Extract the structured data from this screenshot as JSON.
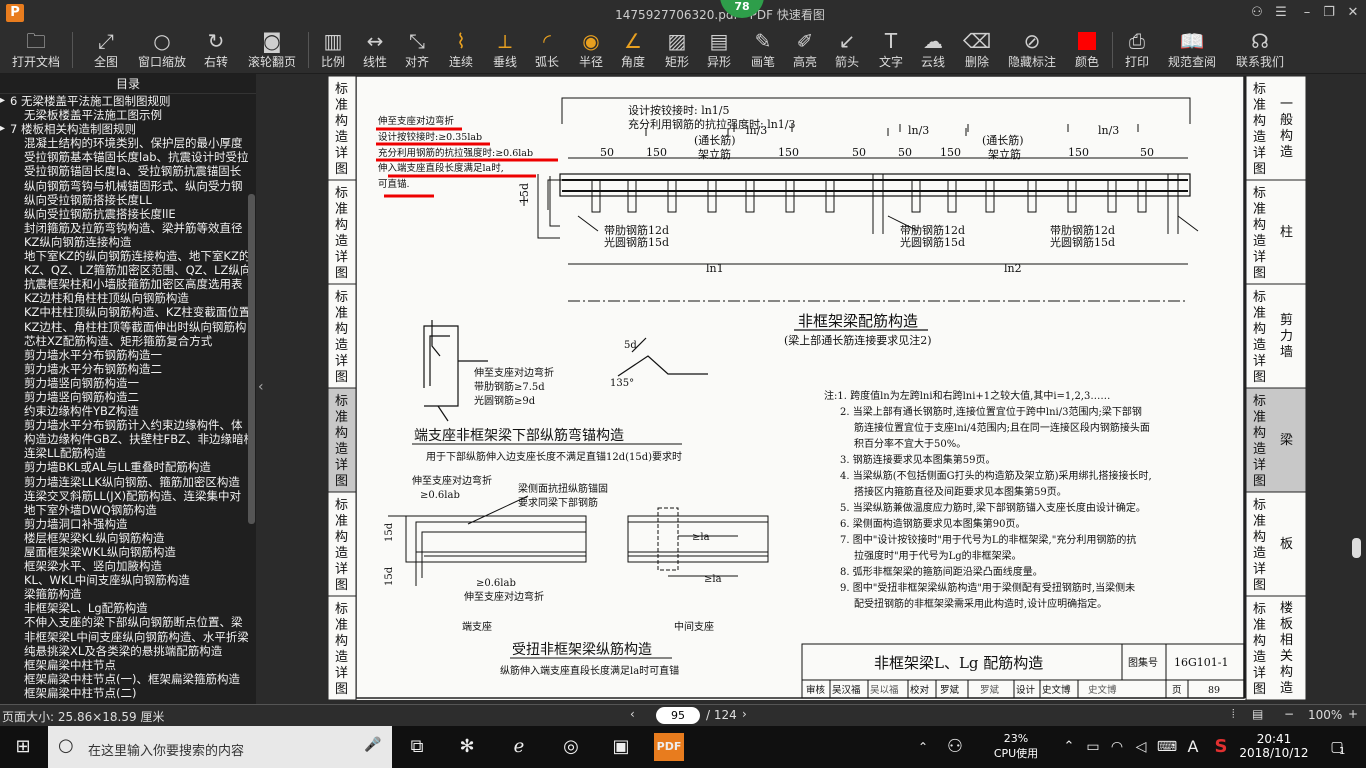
{
  "window": {
    "title": "1475927706320.pdf - PDF 快速看图",
    "badge": "78",
    "logo": "P"
  },
  "toolbar": [
    {
      "label": "打开文档",
      "icon": "folder-icon"
    },
    {
      "label": "全图",
      "icon": "fullscreen-icon"
    },
    {
      "label": "窗口缩放",
      "icon": "zoom-window-icon"
    },
    {
      "label": "右转",
      "icon": "rotate-right-icon"
    },
    {
      "label": "滚轮翻页",
      "icon": "mouse-wheel-icon"
    },
    {
      "label": "比例",
      "icon": "scale-icon"
    },
    {
      "label": "线性",
      "icon": "linear-dim-icon"
    },
    {
      "label": "对齐",
      "icon": "aligned-dim-icon"
    },
    {
      "label": "连续",
      "icon": "continuous-dim-icon"
    },
    {
      "label": "垂线",
      "icon": "perpendicular-icon"
    },
    {
      "label": "弧长",
      "icon": "arc-length-icon"
    },
    {
      "label": "半径",
      "icon": "radius-icon"
    },
    {
      "label": "角度",
      "icon": "angle-icon"
    },
    {
      "label": "矩形",
      "icon": "rectangle-area-icon"
    },
    {
      "label": "异形",
      "icon": "polygon-area-icon"
    },
    {
      "label": "画笔",
      "icon": "pen-icon"
    },
    {
      "label": "高亮",
      "icon": "highlighter-icon"
    },
    {
      "label": "箭头",
      "icon": "arrow-icon"
    },
    {
      "label": "文字",
      "icon": "text-icon"
    },
    {
      "label": "云线",
      "icon": "cloud-icon"
    },
    {
      "label": "删除",
      "icon": "eraser-icon"
    },
    {
      "label": "隐藏标注",
      "icon": "hide-eye-icon"
    },
    {
      "label": "颜色",
      "icon": "color-swatch-icon",
      "color": "#ff0000"
    },
    {
      "label": "打印",
      "icon": "printer-icon"
    },
    {
      "label": "规范查阅",
      "icon": "book-icon"
    },
    {
      "label": "联系我们",
      "icon": "support-icon"
    }
  ],
  "sidebar": {
    "header": "目录",
    "items": [
      {
        "text": "6 无梁楼盖平法施工图制图规则",
        "collapsed": true
      },
      {
        "text": "无梁板楼盖平法施工图示例",
        "collapsed": false
      },
      {
        "text": "7 楼板相关构造制图规则",
        "collapsed": true
      },
      {
        "text": "混凝土结构的环境类别、保护层的最小厚度",
        "collapsed": false
      },
      {
        "text": "受拉钢筋基本锚固长度lab、抗震设计时受拉",
        "collapsed": false
      },
      {
        "text": "受拉钢筋锚固长度la、受拉钢筋抗震锚固长",
        "collapsed": false
      },
      {
        "text": "纵向钢筋弯钩与机械锚固形式、纵向受力钢",
        "collapsed": false
      },
      {
        "text": "纵向受拉钢筋搭接长度LL",
        "collapsed": false
      },
      {
        "text": "纵向受拉钢筋抗震搭接长度llE",
        "collapsed": false
      },
      {
        "text": "封闭箍筋及拉筋弯钩构造、梁并筋等效直径",
        "collapsed": false
      },
      {
        "text": "KZ纵向钢筋连接构造",
        "collapsed": false
      },
      {
        "text": "地下室KZ的纵向钢筋连接构造、地下室KZ的",
        "collapsed": false
      },
      {
        "text": "KZ、QZ、LZ箍筋加密区范围、QZ、LZ纵向钢",
        "collapsed": false
      },
      {
        "text": "抗震框架柱和小墙肢箍筋加密区高度选用表",
        "collapsed": false
      },
      {
        "text": "KZ边柱和角柱柱顶纵向钢筋构造",
        "collapsed": false
      },
      {
        "text": "KZ中柱柱顶纵向钢筋构造、KZ柱变截面位置",
        "collapsed": false
      },
      {
        "text": "KZ边柱、角柱柱顶等截面伸出时纵向钢筋构",
        "collapsed": false
      },
      {
        "text": "芯柱XZ配筋构造、矩形箍筋复合方式",
        "collapsed": false
      },
      {
        "text": "剪力墙水平分布钢筋构造一",
        "collapsed": false
      },
      {
        "text": "剪力墙水平分布钢筋构造二",
        "collapsed": false
      },
      {
        "text": "剪力墙竖向钢筋构造一",
        "collapsed": false
      },
      {
        "text": "剪力墙竖向钢筋构造二",
        "collapsed": false
      },
      {
        "text": "约束边缘构件YBZ构造",
        "collapsed": false
      },
      {
        "text": "剪力墙水平分布钢筋计入约束边缘构件、体",
        "collapsed": false
      },
      {
        "text": "构造边缘构件GBZ、扶壁柱FBZ、非边缘暗柱",
        "collapsed": false
      },
      {
        "text": "连梁LL配筋构造",
        "collapsed": false
      },
      {
        "text": "剪力墙BKL或AL与LL重叠时配筋构造",
        "collapsed": false
      },
      {
        "text": "剪力墙连梁LLK纵向钢筋、箍筋加密区构造",
        "collapsed": false
      },
      {
        "text": "连梁交叉斜筋LL(JX)配筋构造、连梁集中对",
        "collapsed": false
      },
      {
        "text": "地下室外墙DWQ钢筋构造",
        "collapsed": false
      },
      {
        "text": "剪力墙洞口补强构造",
        "collapsed": false
      },
      {
        "text": "楼层框架梁KL纵向钢筋构造",
        "collapsed": false
      },
      {
        "text": "屋面框架梁WKL纵向钢筋构造",
        "collapsed": false
      },
      {
        "text": "框架梁水平、竖向加腋构造",
        "collapsed": false
      },
      {
        "text": "KL、WKL中间支座纵向钢筋构造",
        "collapsed": false
      },
      {
        "text": "梁箍筋构造",
        "collapsed": false
      },
      {
        "text": "非框架梁L、Lg配筋构造",
        "collapsed": false
      },
      {
        "text": "不伸入支座的梁下部纵向钢筋断点位置、梁",
        "collapsed": false
      },
      {
        "text": "非框架梁L中间支座纵向钢筋构造、水平折梁",
        "collapsed": false
      },
      {
        "text": "纯悬挑梁XL及各类梁的悬挑端配筋构造",
        "collapsed": false
      },
      {
        "text": "框架扁梁中柱节点",
        "collapsed": false
      },
      {
        "text": "框架扁梁中柱节点(一)、框架扁梁箍筋构造",
        "collapsed": false
      },
      {
        "text": "框架扁梁中柱节点(二)",
        "collapsed": false
      }
    ]
  },
  "document": {
    "left_tabs": [
      "标准构造详图",
      "标准构造详图",
      "标准构造详图",
      "标准构造详图",
      "标准构造详图",
      "标准构造详图"
    ],
    "right_tabs": [
      {
        "label": "标准构造详图",
        "section": "一般构造",
        "active": false
      },
      {
        "label": "标准构造详图",
        "section": "柱",
        "active": false
      },
      {
        "label": "标准构造详图",
        "section": "剪力墙",
        "active": false
      },
      {
        "label": "标准构造详图",
        "section": "梁",
        "active": true
      },
      {
        "label": "标准构造详图",
        "section": "板",
        "active": false
      },
      {
        "label": "标准构造详图",
        "section": "楼板相关构造",
        "active": false
      }
    ],
    "top_note": [
      "伸至支座对边弯折",
      "设计按铰接时:≥0.35lab",
      "充分利用钢筋的抗拉强度时:≥0.6lab",
      "伸入端支座直段长度满足la时,",
      "可直锚."
    ],
    "dim_notes": [
      "设计按铰接时: ln1/5",
      "充分利用钢筋的抗拉强度时: ln1/3"
    ],
    "labels": {
      "tongchang1": "(通长筋)",
      "jialijin": "架立筋",
      "tongchang2": "(通长筋)",
      "jialijin2": "架立筋",
      "ln3": "ln/3",
      "d50": "50",
      "d150": "150",
      "dai12": "带肋钢筋12d",
      "guang15": "光圆钢筋15d",
      "ln1": "ln1",
      "ln2": "ln2",
      "d15": "15d"
    },
    "main_title": "非框架梁配筋构造",
    "main_subtitle": "(梁上部通长筋连接要求见注2)",
    "hook_labels": [
      "5d",
      "135°"
    ],
    "bend_note": [
      "伸至支座对边弯折",
      "带肋钢筋≥7.5d",
      "光圆钢筋≥9d"
    ],
    "bend_title": "端支座非框架梁下部纵筋弯锚构造",
    "bend_subtitle": "用于下部纵筋伸入边支座长度不满足直锚12d(15d)要求时",
    "torsion_labels": [
      "伸至支座对边弯折",
      "≥0.6lab",
      "梁侧面抗扭纵筋锚固",
      "要求同梁下部钢筋",
      "15d",
      "15d",
      "≥0.6lab",
      "伸至支座对边弯折",
      "≥la",
      "≥la"
    ],
    "end_support": "端支座",
    "mid_support": "中间支座",
    "torsion_title": "受扭非框架梁纵筋构造",
    "torsion_subtitle": "纵筋伸入端支座直段长度满足la时可直锚",
    "notes": [
      "注:1. 跨度值ln为左跨lni和右跨lni+1之较大值,其中i=1,2,3……",
      "2. 当梁上部有通长钢筋时,连接位置宜位于跨中lni/3范围内;梁下部钢",
      "筋连接位置宜位于支座lni/4范围内;且在同一连接区段内钢筋接头面",
      "积百分率不宜大于50%。",
      "3. 钢筋连接要求见本图集第59页。",
      "4. 当梁纵筋(不包括侧面G打头的构造筋及架立筋)采用绑扎搭接接长时,",
      "搭接区内箍筋直径及间距要求见本图集第59页。",
      "5. 当梁纵筋兼做温度应力筋时,梁下部钢筋锚入支座长度由设计确定。",
      "6. 梁侧面构造钢筋要求见本图集第90页。",
      "7. 图中\"设计按铰接时\"用于代号为L的非框架梁,\"充分利用钢筋的抗",
      "拉强度时\"用于代号为Lg的非框架梁。",
      "8. 弧形非框架梁的箍筋间距沿梁凸面线度量。",
      "9. 图中\"受扭非框架梁纵筋构造\"用于梁侧配有受扭钢筋时,当梁侧未",
      "配受扭钢筋的非框架梁需采用此构造时,设计应明确指定。"
    ],
    "titleblock": {
      "title": "非框架梁L、Lg 配筋构造",
      "atlas_label": "图集号",
      "atlas": "16G101-1",
      "row": [
        "审核",
        "吴汉福",
        "吴以福",
        "校对",
        "罗斌",
        "罗斌",
        "设计",
        "史文博",
        "史文博",
        "页",
        "89"
      ]
    }
  },
  "statusbar": {
    "page_size": "页面大小: 25.86×18.59 厘米",
    "current_page": "95",
    "total_pages": "/ 124",
    "zoom": "100%"
  },
  "taskbar": {
    "search_placeholder": "在这里输入你要搜索的内容",
    "cpu_percent": "23%",
    "cpu_label": "CPU使用",
    "ime": "A",
    "time": "20:41",
    "date": "2018/10/12",
    "notifications": "1"
  },
  "colors": {
    "accent": "#e87c1e",
    "annotation": "#ff0000",
    "active_tab": "#c8c8c8"
  }
}
